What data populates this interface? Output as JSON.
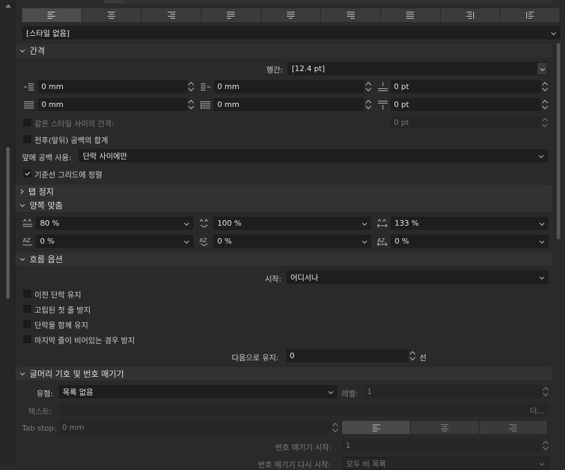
{
  "paragraph_style_select": {
    "value": "[스타일 없음]"
  },
  "spacing": {
    "title": "간격",
    "leading_label": "행간:",
    "leading_value": "[12.4 pt]",
    "left_indent": "0 mm",
    "first_line_indent": "0 mm",
    "space_before": "0 pt",
    "right_indent": "0 mm",
    "last_line_indent": "0 mm",
    "space_after": "0 pt",
    "same_style_spacing_label": "같은 스타일 사이의 간격:",
    "same_style_spacing_value": "0 pt",
    "sum_spacing_label": "전후(앞뒤) 공백의 합계",
    "space_before_use_label": "앞에 공백 사용:",
    "space_before_use_value": "단락 사이에만",
    "align_baseline_label": "기준선 그리드에 정렬"
  },
  "tab_stops": {
    "title": "탭 정지"
  },
  "justification": {
    "title": "양쪽 맞춤",
    "word_spacing": "80 %",
    "letter_spacing_min": "100 %",
    "letter_spacing_max": "133 %",
    "val1": "0 %",
    "val2": "0 %",
    "val3": "0 %"
  },
  "flow": {
    "title": "흐름 옵션",
    "start_label": "시작:",
    "start_value": "어디서나",
    "keep_previous": "이전 단락 유지",
    "orphan": "고립된 첫 줄 방지",
    "keep_together": "단락을 함께 유지",
    "widow": "마지막 줄이 비어있는 경우 방지",
    "keep_with_next_label": "다음으로 유지:",
    "keep_with_next_value": "0",
    "lines_suffix": "선"
  },
  "bullets": {
    "title": "글머리 기호 및 번호 매기기",
    "type_label": "유형:",
    "type_value": "목록 없음",
    "level_label": "레벨:",
    "level_value": "1",
    "text_label": "텍스트:",
    "text_more": "더...",
    "tabstop_label": "Tab stop:",
    "tabstop_value": "0 mm",
    "numbering_start_label": "번호 매기기 시작:",
    "numbering_start_value": "1",
    "restart_label": "번호 매기기 다시 시작:",
    "restart_value": "모두 비 목록"
  },
  "colors": {
    "bg": "#2a2a2a",
    "field": "#1e1e1e",
    "section": "#303030"
  }
}
